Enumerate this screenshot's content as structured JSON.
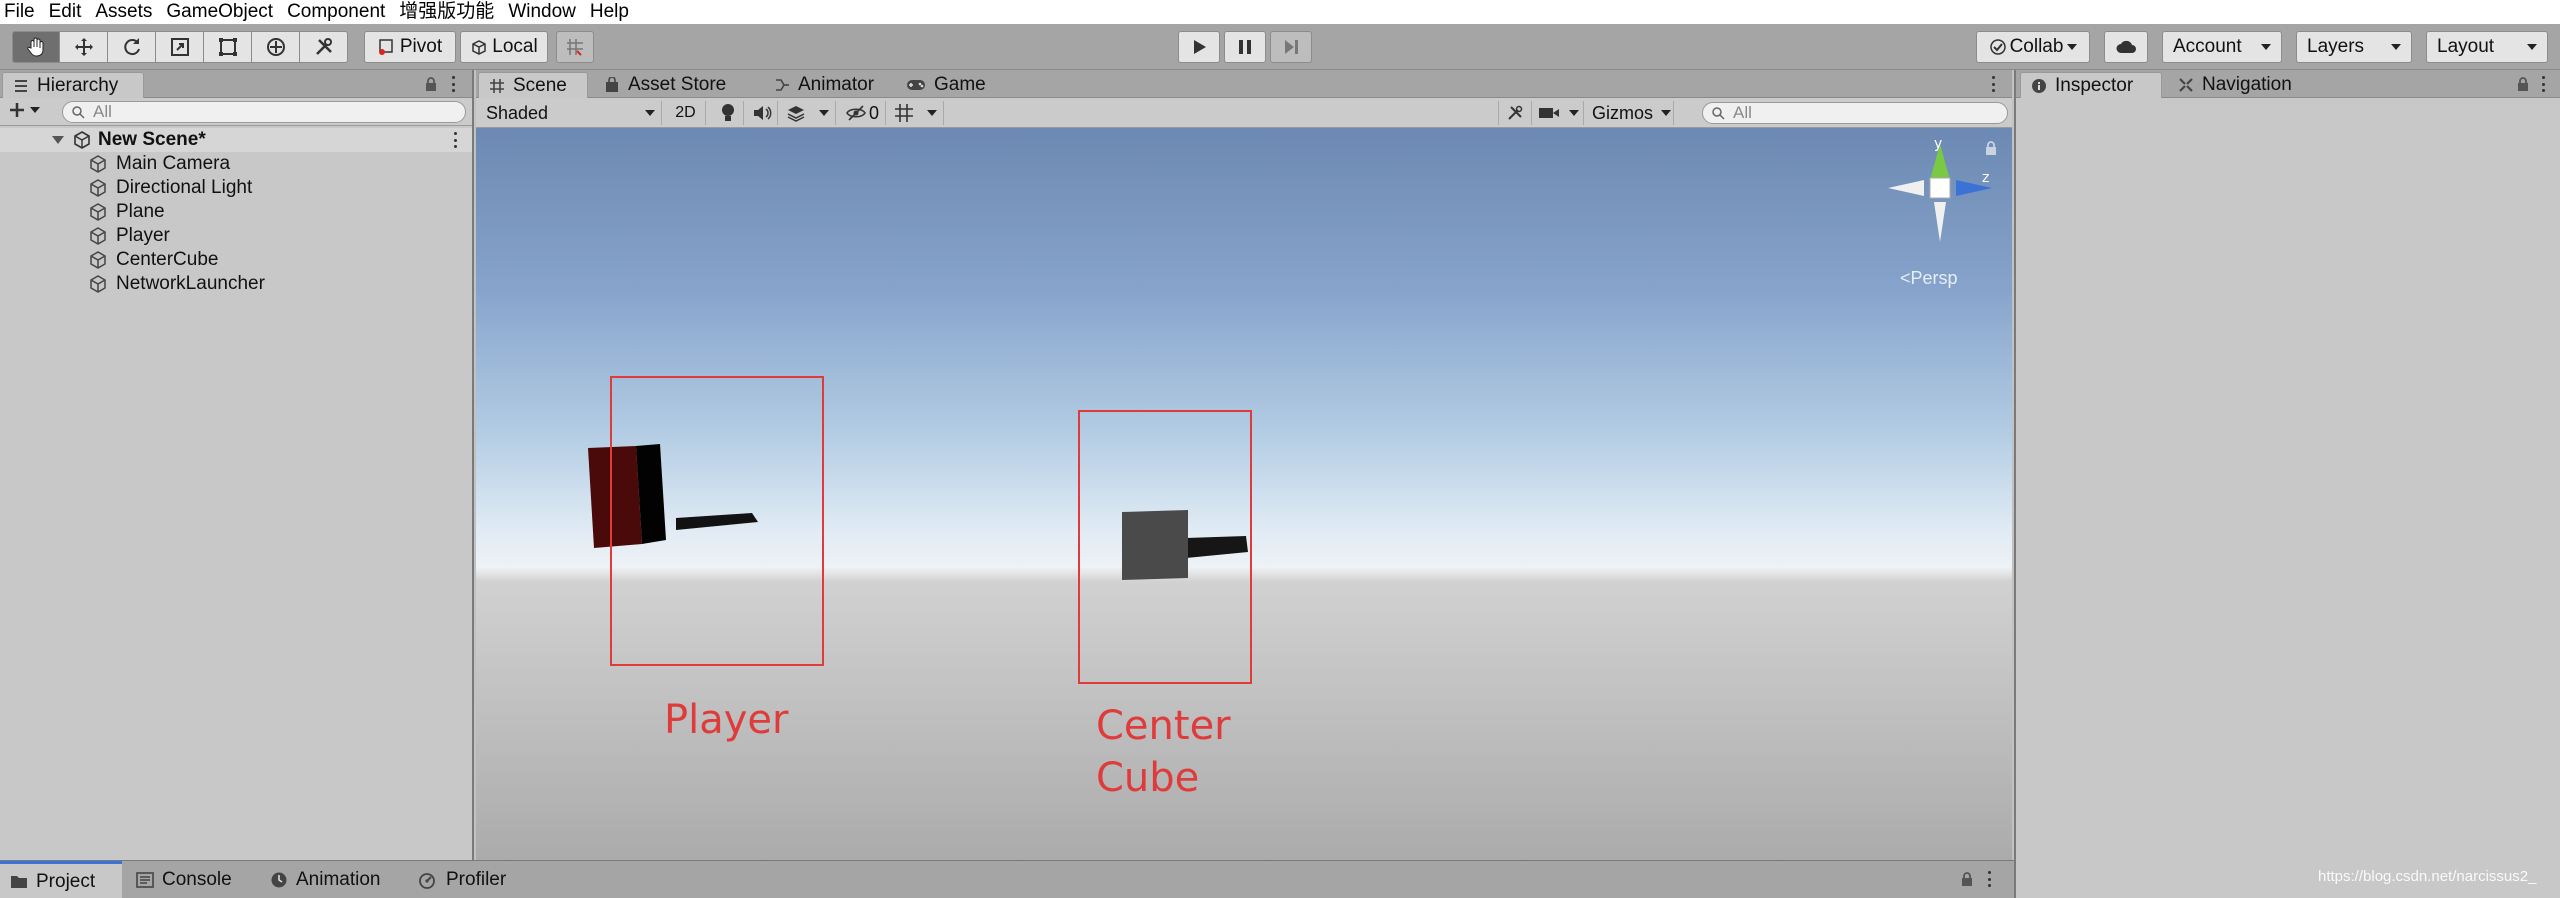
{
  "menu": [
    "File",
    "Edit",
    "Assets",
    "GameObject",
    "Component",
    "增强版功能",
    "Window",
    "Help"
  ],
  "toolbar": {
    "pivot_label": "Pivot",
    "local_label": "Local",
    "collab_label": "Collab",
    "account_label": "Account",
    "layers_label": "Layers",
    "layout_label": "Layout"
  },
  "hierarchy": {
    "tab_label": "Hierarchy",
    "search_placeholder": "All",
    "scene_name": "New Scene*",
    "items": [
      "Main Camera",
      "Directional Light",
      "Plane",
      "Player",
      "CenterCube",
      "NetworkLauncher"
    ]
  },
  "scene": {
    "tabs": [
      "Scene",
      "Asset Store",
      "Animator",
      "Game"
    ],
    "shading_mode": "Shaded",
    "mode_2d_label": "2D",
    "hidden_count": "0",
    "gizmos_label": "Gizmos",
    "search_placeholder": "All",
    "persp_label": "<Persp",
    "axis_y": "y",
    "axis_z": "z"
  },
  "annotations": {
    "player_label": "Player",
    "center_cube_label": "Center\nCube",
    "color": "#e03b3b"
  },
  "inspector": {
    "tabs": [
      "Inspector",
      "Navigation"
    ]
  },
  "bottom": {
    "tabs": [
      "Project",
      "Console",
      "Animation",
      "Profiler"
    ]
  },
  "watermark": "https://blog.csdn.net/narcissus2_"
}
